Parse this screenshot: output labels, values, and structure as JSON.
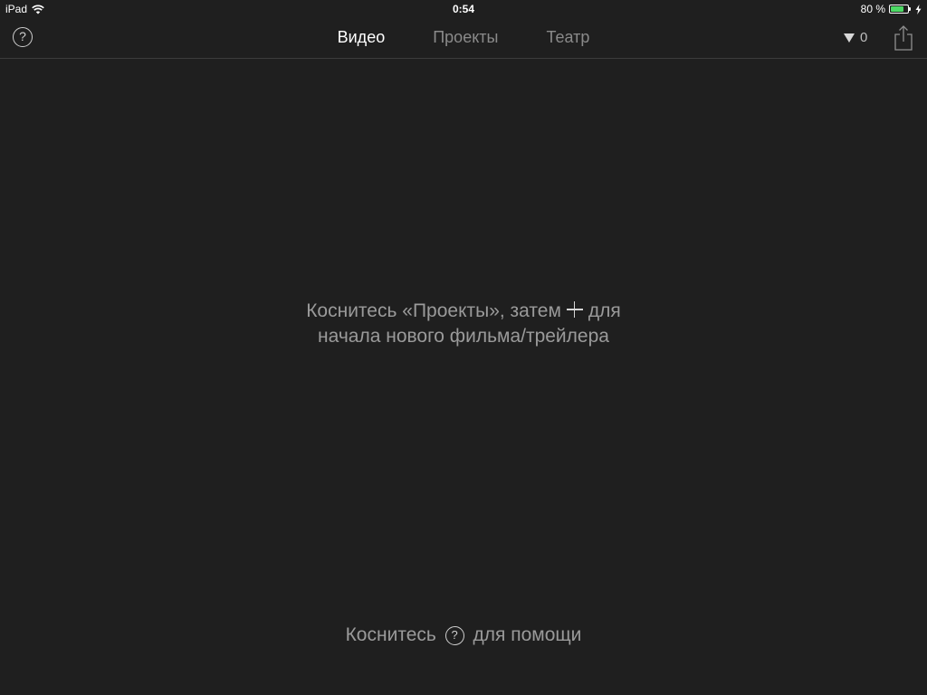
{
  "status_bar": {
    "device": "iPad",
    "time": "0:54",
    "battery_text": "80 %",
    "battery_level": 0.8
  },
  "toolbar": {
    "help_glyph": "?",
    "tabs": [
      {
        "label": "Видео",
        "active": true
      },
      {
        "label": "Проекты",
        "active": false
      },
      {
        "label": "Театр",
        "active": false
      }
    ],
    "filter_count": "0"
  },
  "message": {
    "line1_before": "Коснитесь «Проекты», затем",
    "line1_after": "для",
    "line2": "начала нового фильма/трейлера"
  },
  "help_hint": {
    "before": "Коснитесь",
    "glyph": "?",
    "after": "для помощи"
  },
  "colors": {
    "background": "#1f1f1f",
    "battery": "#4cd964"
  },
  "icons": [
    "wifi-icon",
    "battery-icon",
    "charging-icon",
    "help-icon",
    "filter-triangle-icon",
    "share-icon",
    "plus-icon"
  ]
}
